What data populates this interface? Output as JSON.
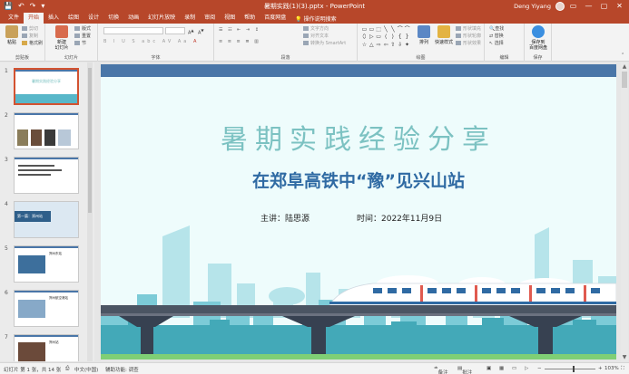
{
  "titlebar": {
    "document_title": "暑期实践(1)(3).pptx - PowerPoint",
    "user_name": "Deng Yiyang",
    "qat": [
      "💾",
      "↶",
      "↷",
      "▾"
    ],
    "window_buttons": [
      "▭",
      "—",
      "▢",
      "✕"
    ]
  },
  "tabs": {
    "file": "文件",
    "items": [
      "开始",
      "插入",
      "绘图",
      "设计",
      "切换",
      "动画",
      "幻灯片放映",
      "录制",
      "审阅",
      "视图",
      "帮助",
      "百度网盘"
    ],
    "active_index": 0,
    "tell_me": "操作说明搜索"
  },
  "ribbon": {
    "clipboard": {
      "label": "剪贴板",
      "paste": "粘贴",
      "cut": "剪切",
      "copy": "复制",
      "format_painter": "格式刷"
    },
    "slides": {
      "label": "幻灯片",
      "new_slide": "新建\n幻灯片",
      "layout": "版式",
      "reset": "重置",
      "section": "节"
    },
    "font": {
      "label": "字体",
      "buttons": [
        "B",
        "I",
        "U",
        "S",
        "abc",
        "AV",
        "Aa",
        "A"
      ]
    },
    "paragraph": {
      "label": "段落",
      "text_direction": "文字方向",
      "align_text": "对齐文本",
      "smartart": "转换为 SmartArt"
    },
    "drawing": {
      "label": "绘图",
      "shapes": [
        "▭",
        "▭",
        "⬚",
        "╲",
        "╲",
        "⌒",
        "⌒",
        "⬯",
        "▷",
        "▭",
        "⟨",
        "⟩",
        "{",
        "}",
        "☆",
        "△",
        "⇨",
        "⇦",
        "⇧",
        "⇩",
        "✦"
      ],
      "arrange": "排列",
      "quick_styles": "快速样式",
      "shape_fill": "形状填充",
      "shape_outline": "形状轮廓",
      "shape_effects": "形状效果"
    },
    "editing": {
      "label": "编辑",
      "find": "查找",
      "replace": "替换",
      "select": "选择"
    },
    "protect": {
      "label": "保存",
      "save_to": "保存到\n百度网盘"
    }
  },
  "slide_panel": {
    "numbers": [
      "1",
      "2",
      "3",
      "4",
      "5",
      "6",
      "7"
    ],
    "selected_index": 0,
    "thumb_titles": [
      "暑期实践经验分享",
      "",
      "",
      "第一篇：郑州站",
      "郑州东站",
      "郑州航空港站",
      "郑州站"
    ]
  },
  "slide": {
    "title": "暑期实践经验分享",
    "subtitle": "在郑阜高铁中“豫”见兴山站",
    "speaker": "主讲：陆思源",
    "date": "时间：2022年11月9日",
    "colors": {
      "top_band": "#4a76a8",
      "title": "#7cc2c2",
      "subtitle": "#2f6aa3",
      "background": "#eefcfc"
    }
  },
  "statusbar": {
    "slide_info": "幻灯片 第 1 张，共 14 张",
    "language": "中文(中国)",
    "accessibility": "辅助功能: 调查",
    "notes": "备注",
    "comments": "批注",
    "zoom": "103%"
  }
}
